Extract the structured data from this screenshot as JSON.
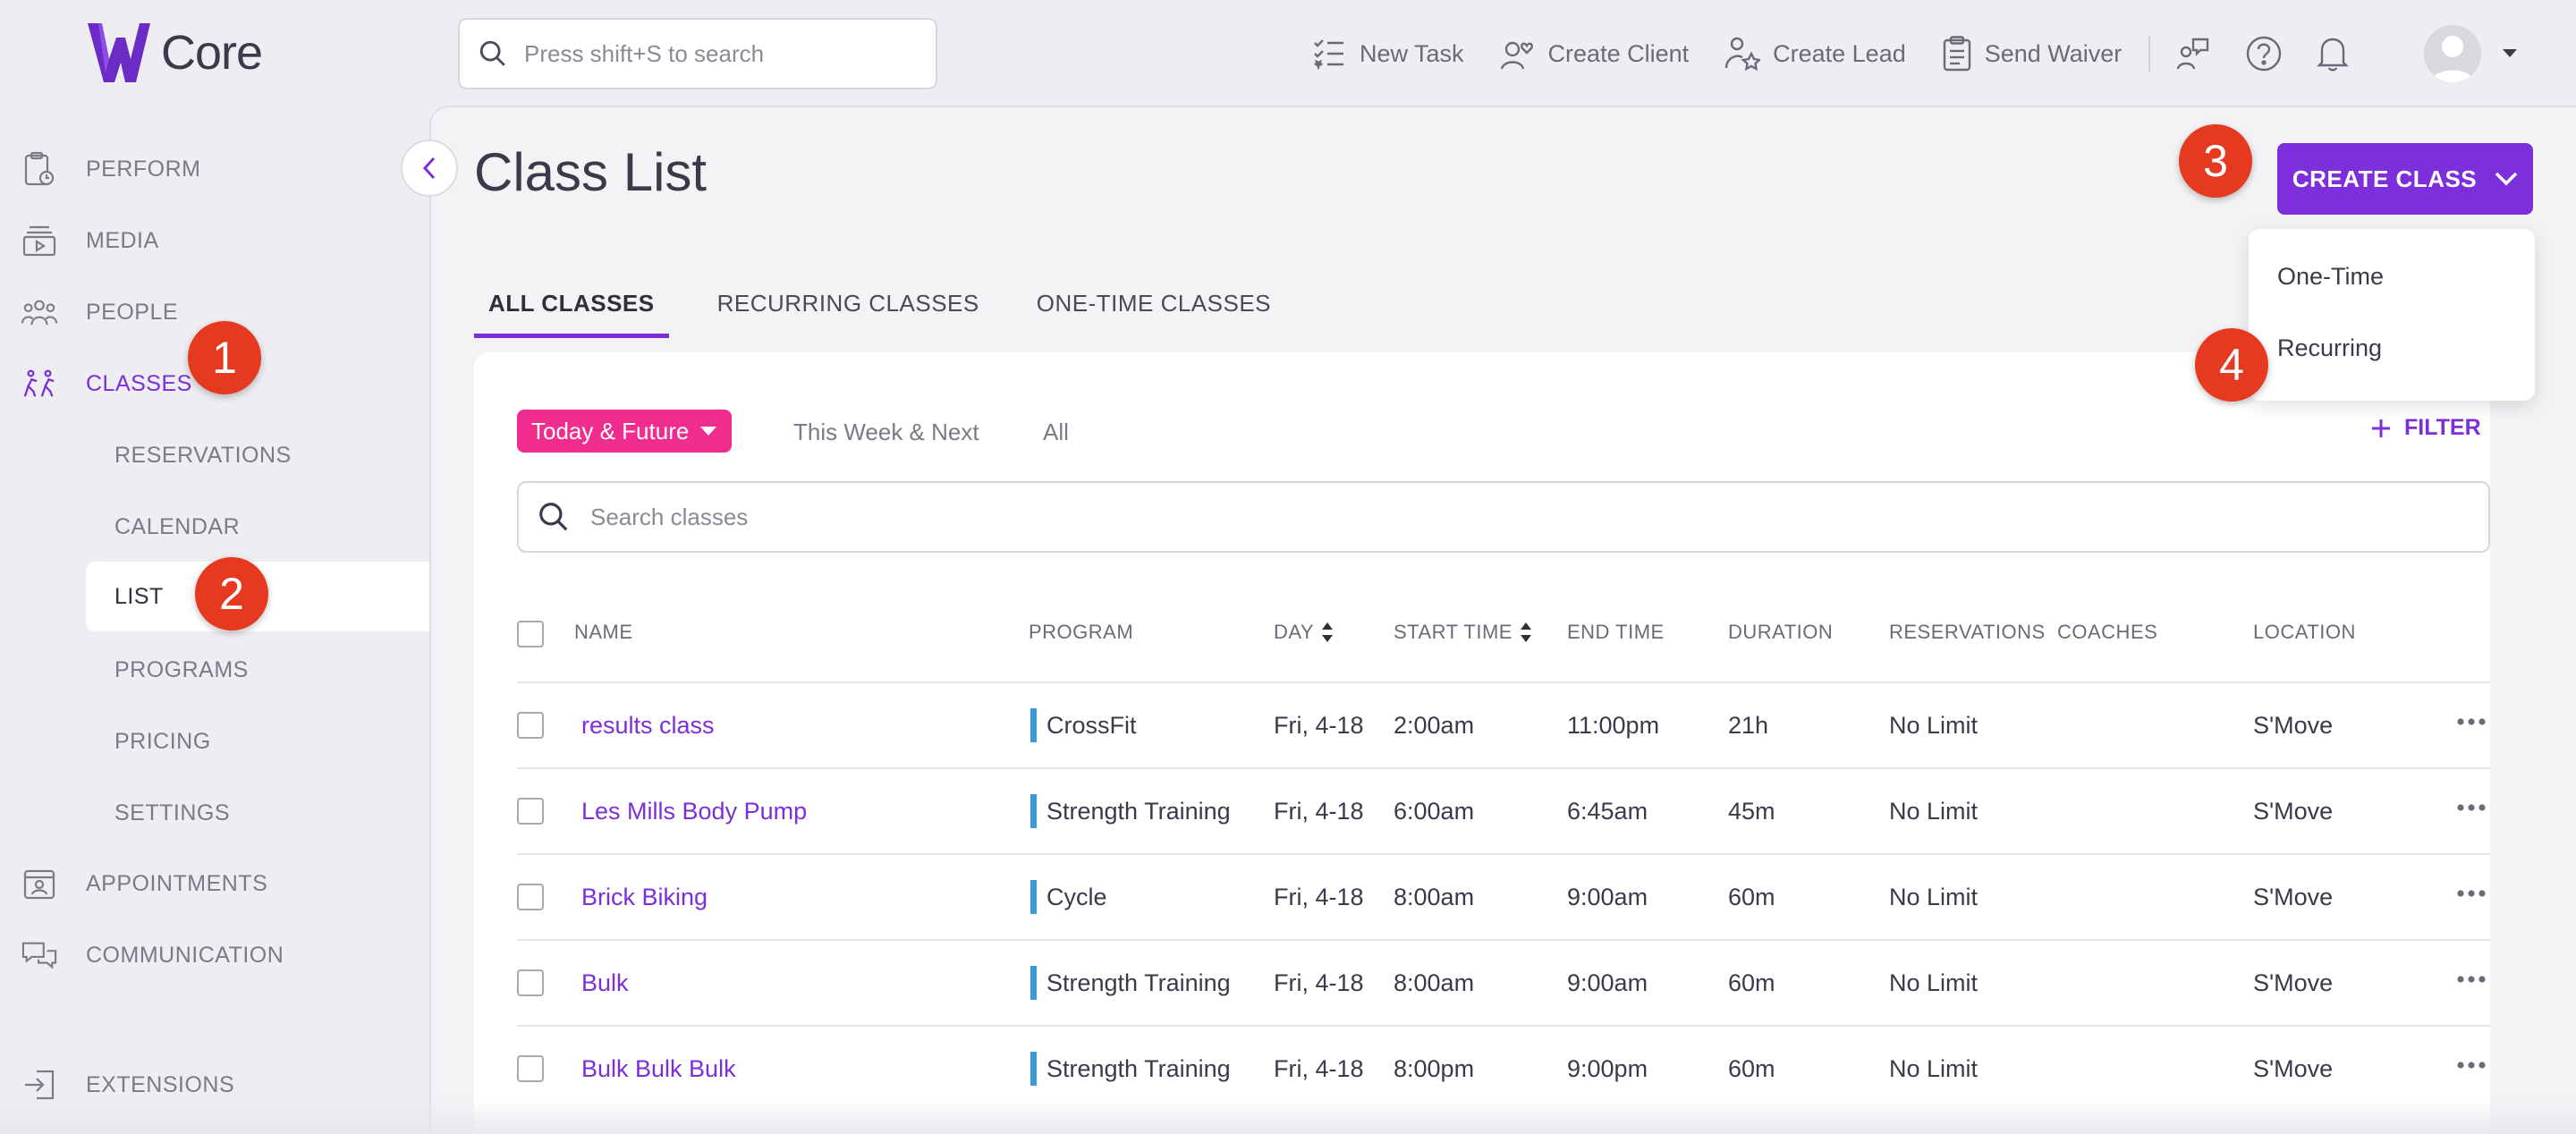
{
  "app": {
    "logo_text": "Core",
    "brand_color": "#7c2fd9"
  },
  "search": {
    "placeholder": "Press shift+S to search"
  },
  "top_actions": [
    {
      "label": "New Task",
      "icon": "task-list-icon"
    },
    {
      "label": "Create Client",
      "icon": "person-heart-icon"
    },
    {
      "label": "Create Lead",
      "icon": "person-star-icon"
    },
    {
      "label": "Send Waiver",
      "icon": "clipboard-icon"
    }
  ],
  "sidebar": {
    "items": [
      {
        "label": "PERFORM",
        "icon": "clipboard-clock-icon"
      },
      {
        "label": "MEDIA",
        "icon": "media-stack-icon"
      },
      {
        "label": "PEOPLE",
        "icon": "people-group-icon"
      },
      {
        "label": "CLASSES",
        "icon": "classes-running-icon"
      },
      {
        "label": "APPOINTMENTS",
        "icon": "calendar-person-icon"
      },
      {
        "label": "COMMUNICATION",
        "icon": "chat-bubbles-icon"
      },
      {
        "label": "EXTENSIONS",
        "icon": "extension-arrow-icon"
      }
    ],
    "sub_items": [
      {
        "label": "RESERVATIONS"
      },
      {
        "label": "CALENDAR"
      },
      {
        "label": "LIST"
      },
      {
        "label": "PROGRAMS"
      },
      {
        "label": "PRICING"
      },
      {
        "label": "SETTINGS"
      }
    ]
  },
  "page": {
    "title": "Class List"
  },
  "create_button": {
    "label": "CREATE CLASS"
  },
  "dropdown": {
    "items": [
      "One-Time",
      "Recurring"
    ]
  },
  "tabs": [
    "ALL CLASSES",
    "RECURRING CLASSES",
    "ONE-TIME CLASSES"
  ],
  "filters": {
    "selected": "Today & Future",
    "options": [
      "This Week & Next",
      "All"
    ],
    "filter_label": "FILTER"
  },
  "class_search": {
    "placeholder": "Search classes"
  },
  "table": {
    "headers": [
      "NAME",
      "PROGRAM",
      "DAY",
      "START TIME",
      "END TIME",
      "DURATION",
      "RESERVATIONS",
      "COACHES",
      "LOCATION"
    ],
    "rows": [
      {
        "name": "results class",
        "program": "CrossFit",
        "day": "Fri, 4-18",
        "start": "2:00am",
        "end": "11:00pm",
        "duration": "21h",
        "reservations": "No Limit",
        "coaches": "",
        "location": "S'Move"
      },
      {
        "name": "Les Mills Body Pump",
        "program": "Strength Training",
        "day": "Fri, 4-18",
        "start": "6:00am",
        "end": "6:45am",
        "duration": "45m",
        "reservations": "No Limit",
        "coaches": "",
        "location": "S'Move"
      },
      {
        "name": "Brick Biking",
        "program": "Cycle",
        "day": "Fri, 4-18",
        "start": "8:00am",
        "end": "9:00am",
        "duration": "60m",
        "reservations": "No Limit",
        "coaches": "",
        "location": "S'Move"
      },
      {
        "name": "Bulk",
        "program": "Strength Training",
        "day": "Fri, 4-18",
        "start": "8:00am",
        "end": "9:00am",
        "duration": "60m",
        "reservations": "No Limit",
        "coaches": "",
        "location": "S'Move"
      },
      {
        "name": "Bulk Bulk Bulk",
        "program": "Strength Training",
        "day": "Fri, 4-18",
        "start": "8:00pm",
        "end": "9:00pm",
        "duration": "60m",
        "reservations": "No Limit",
        "coaches": "",
        "location": "S'Move"
      }
    ]
  },
  "step_badges": [
    "1",
    "2",
    "3",
    "4"
  ]
}
